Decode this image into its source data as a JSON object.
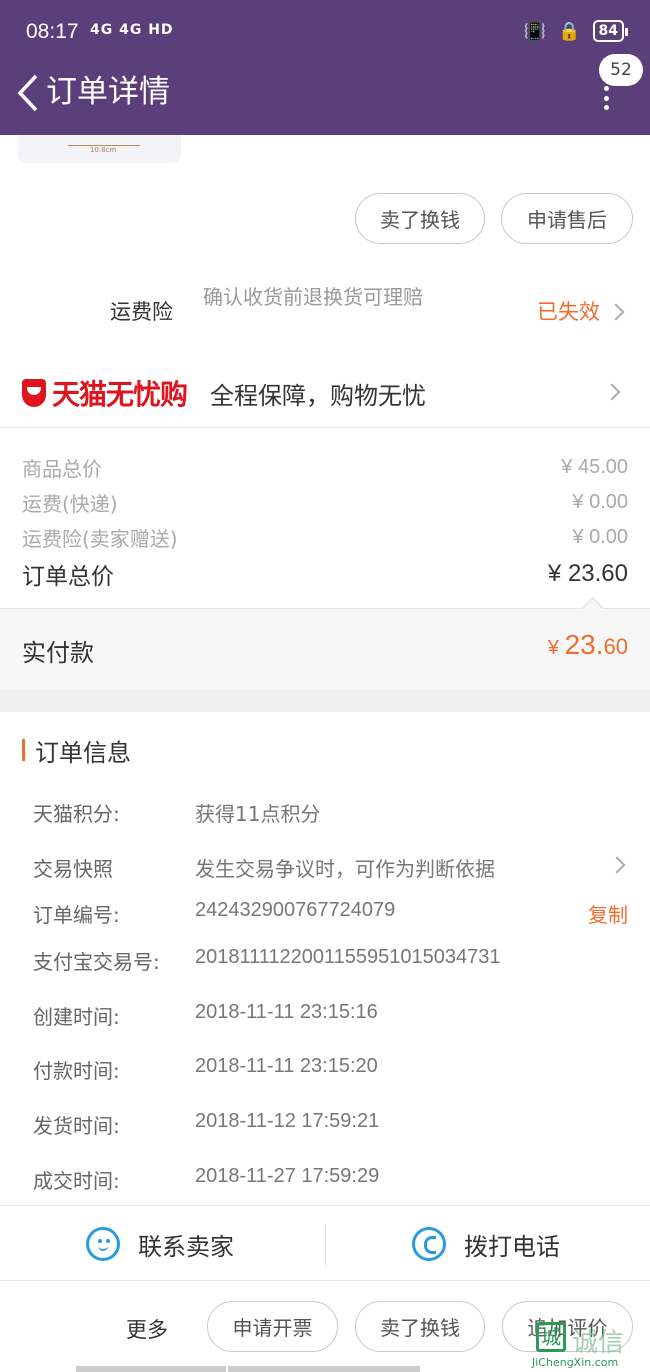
{
  "status_bar": {
    "time": "08:17",
    "signal": "4G 4G HD",
    "battery": "84"
  },
  "header": {
    "title": "订单详情",
    "badge_count": "52"
  },
  "thumbnail": {
    "caption": "10.8cm"
  },
  "item_actions": {
    "sell_label": "卖了换钱",
    "aftersale_label": "申请售后"
  },
  "insurance": {
    "label": "运费险",
    "desc": "确认收货前退换货可理赔",
    "status": "已失效"
  },
  "tmall_guarantee": {
    "brand": "天猫无忧购",
    "text": "全程保障，购物无忧"
  },
  "prices": {
    "items": [
      {
        "label": "商品总价",
        "value": "¥ 45.00"
      },
      {
        "label": "运费(快递)",
        "value": "¥ 0.00"
      },
      {
        "label": "运费险(卖家赠送)",
        "value": "¥ 0.00"
      }
    ],
    "total_label": "订单总价",
    "total_value": "¥ 23.60",
    "paid_label": "实付款",
    "paid_currency": "¥ ",
    "paid_int": "23.",
    "paid_dec": "60"
  },
  "order_info": {
    "title": "订单信息",
    "rows": [
      {
        "key": "天猫积分:",
        "value": "获得11点积分"
      },
      {
        "key": "交易快照",
        "value": "发生交易争议时，可作为判断依据"
      },
      {
        "key": "订单编号:",
        "value": "242432900767724079",
        "action": "复制"
      },
      {
        "key": "支付宝交易号:",
        "value": "2018111122001155951015034731"
      },
      {
        "key": "创建时间:",
        "value": "2018-11-11 23:15:16"
      },
      {
        "key": "付款时间:",
        "value": "2018-11-11 23:15:20"
      },
      {
        "key": "发货时间:",
        "value": "2018-11-12 17:59:21"
      },
      {
        "key": "成交时间:",
        "value": "2018-11-27 17:59:29"
      }
    ]
  },
  "contact": {
    "seller_label": "联系卖家",
    "call_label": "拨打电话"
  },
  "footer": {
    "more_label": "更多",
    "invoice_label": "申请开票",
    "sell_label": "卖了换钱",
    "review_label": "追加评价"
  },
  "watermark": {
    "icon_char": "城",
    "brand": "诚信",
    "url": "JiChengXin.com"
  },
  "colors": {
    "header": "#5b3f7b",
    "accent": "#f06e2d",
    "tmall_red": "#e0141e",
    "icon_blue": "#2a9ae0"
  }
}
